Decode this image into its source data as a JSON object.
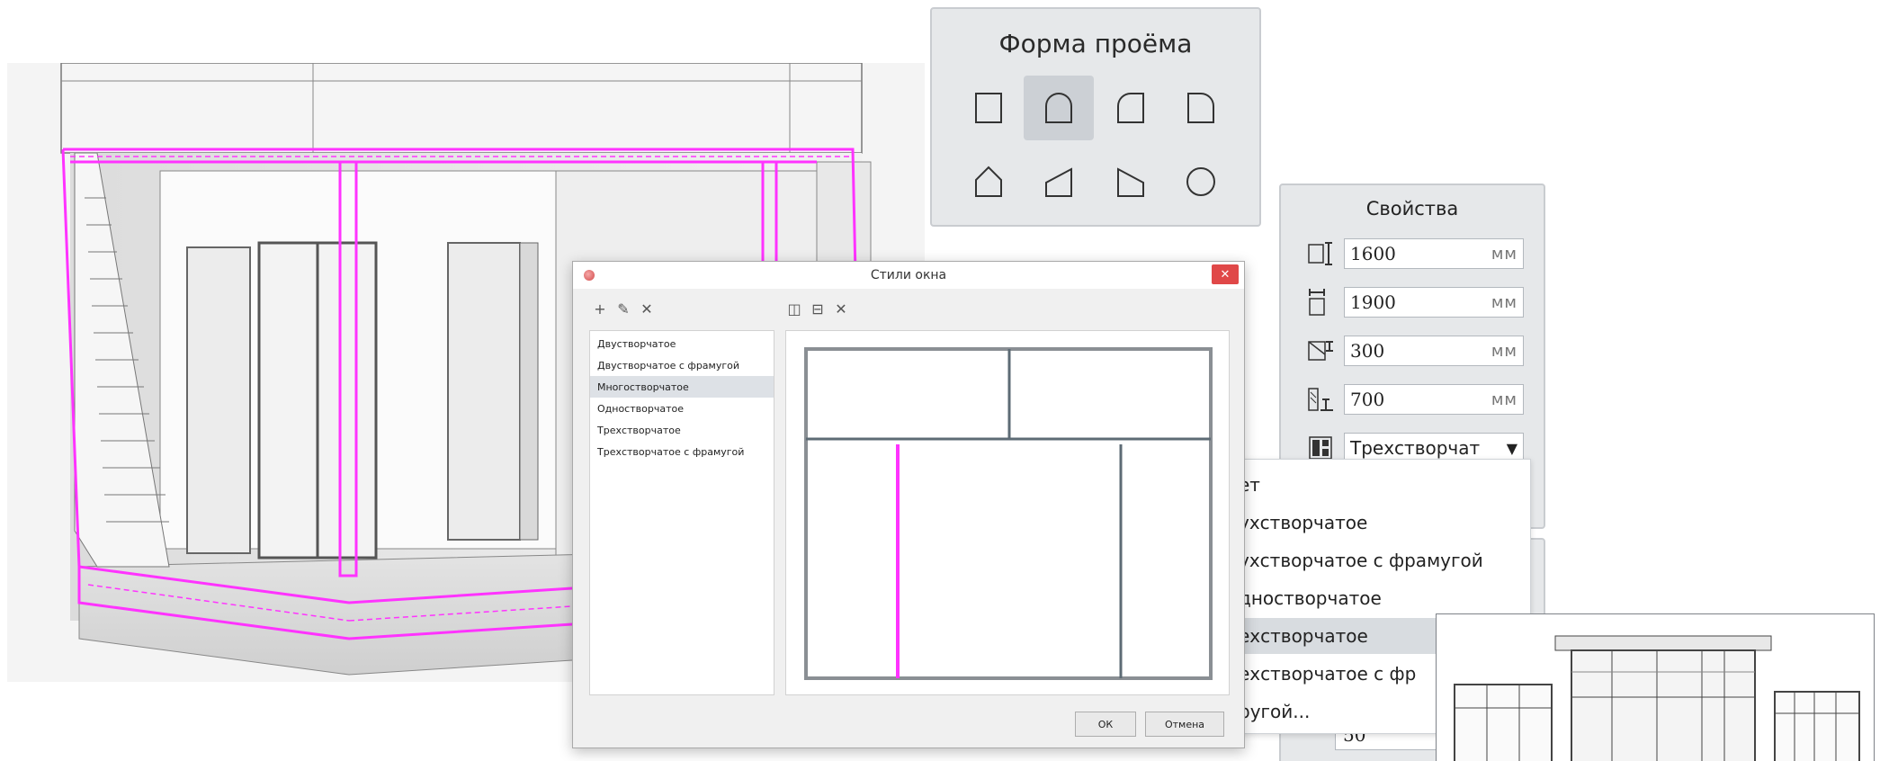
{
  "shape_panel": {
    "title": "Форма проёма",
    "shapes": [
      {
        "icon": "rectangle-shape-icon",
        "selected": false
      },
      {
        "icon": "arch-shape-icon",
        "selected": true
      },
      {
        "icon": "left-rounded-shape-icon",
        "selected": false
      },
      {
        "icon": "right-rounded-shape-icon",
        "selected": false
      },
      {
        "icon": "pentagon-shape-icon",
        "selected": false
      },
      {
        "icon": "sloped-left-shape-icon",
        "selected": false
      },
      {
        "icon": "sloped-right-shape-icon",
        "selected": false
      },
      {
        "icon": "circle-shape-icon",
        "selected": false
      }
    ]
  },
  "properties": {
    "title": "Свойства",
    "height": {
      "value": "1600",
      "unit": "мм",
      "icon": "height-icon"
    },
    "width": {
      "value": "1900",
      "unit": "мм",
      "icon": "width-icon"
    },
    "top_offset": {
      "value": "300",
      "unit": "мм",
      "icon": "top-offset-icon"
    },
    "sill_height": {
      "value": "700",
      "unit": "мм",
      "icon": "sill-height-icon"
    },
    "style": {
      "value": "Трехстворчат",
      "icon": "window-style-icon"
    },
    "partial_value": "50"
  },
  "dropdown": {
    "items": [
      {
        "label": "ет",
        "active": false
      },
      {
        "label": "ухстворчатое",
        "active": false
      },
      {
        "label": "ухстворчатое с фрамугой",
        "active": false
      },
      {
        "label": "дностворчатое",
        "active": false
      },
      {
        "label": "ехстворчатое",
        "active": true
      },
      {
        "label": "ехстворчатое с фр",
        "active": false
      },
      {
        "label": "ругой...",
        "active": false
      }
    ]
  },
  "dialog": {
    "title": "Стили окна",
    "close_label": "✕",
    "toolbar_left": {
      "add": "+",
      "edit": "✎",
      "delete": "✕"
    },
    "toolbar_right": {
      "split_vertical": "◫",
      "split_horizontal": "⊟",
      "delete": "✕"
    },
    "styles": [
      {
        "label": "Двустворчатое",
        "active": false
      },
      {
        "label": "Двустворчатое с фрамугой",
        "active": false
      },
      {
        "label": "Многостворчатое",
        "active": true
      },
      {
        "label": "Одностворчатое",
        "active": false
      },
      {
        "label": "Трехстворчатое",
        "active": false
      },
      {
        "label": "Трехстворчатое с фрамугой",
        "active": false
      }
    ],
    "ok_label": "ОК",
    "cancel_label": "Отмена"
  },
  "colors": {
    "selection": "#ff33ff",
    "mullion": "#5d6b75",
    "panel_bg": "#e6e8ea",
    "close_red": "#e04848"
  }
}
